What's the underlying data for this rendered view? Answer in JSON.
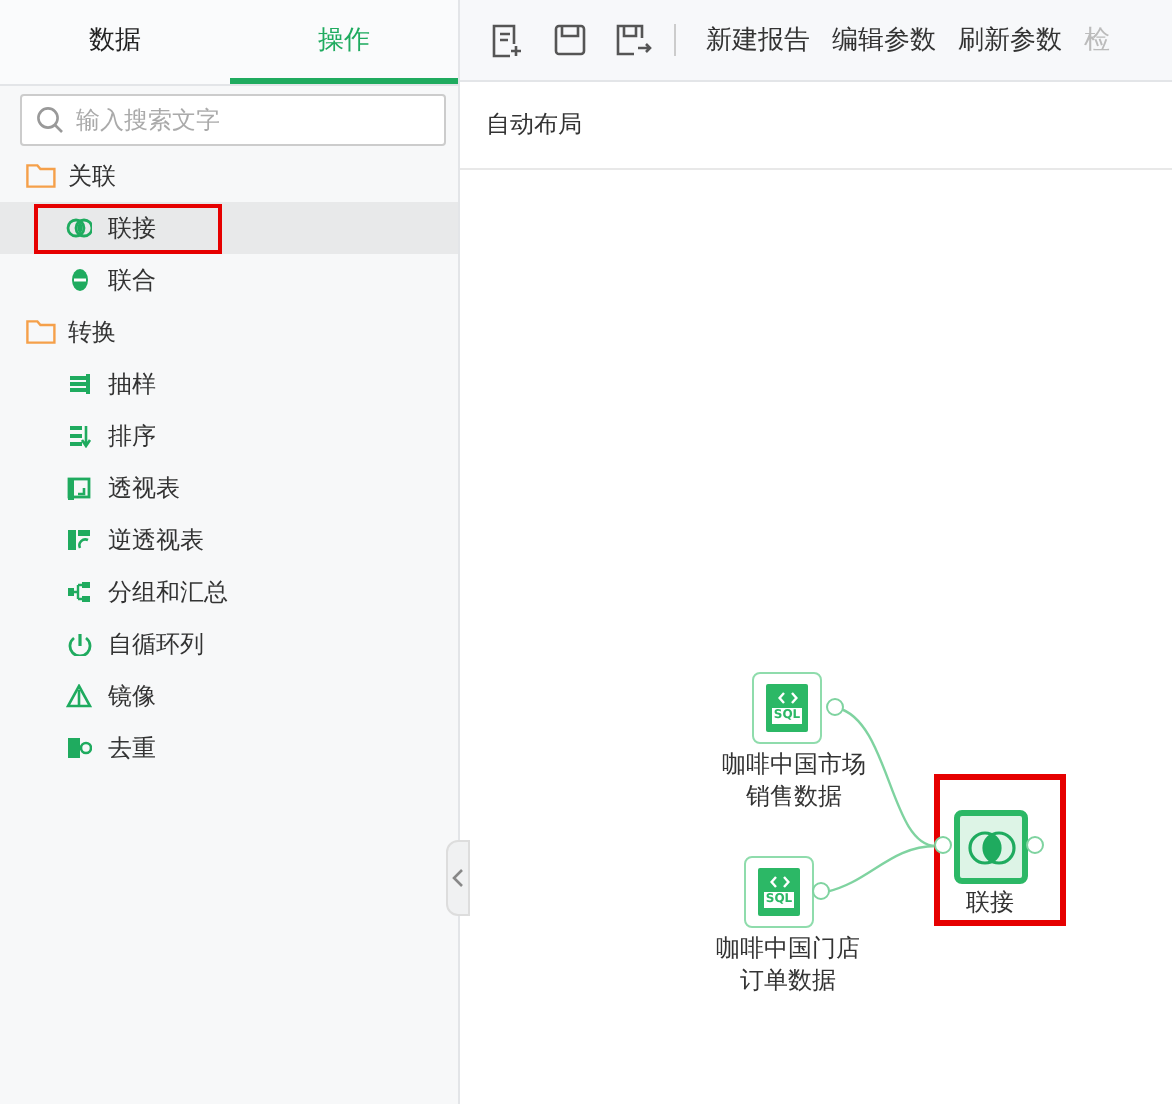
{
  "left_tabs": [
    {
      "label": "数据",
      "selected": false
    },
    {
      "label": "操作",
      "selected": true
    }
  ],
  "search": {
    "placeholder": "输入搜索文字"
  },
  "tree": [
    {
      "label": "关联",
      "children": [
        {
          "label": "联接",
          "selected": true,
          "highlighted": true
        },
        {
          "label": "联合",
          "selected": false,
          "highlighted": false
        }
      ]
    },
    {
      "label": "转换",
      "children": [
        {
          "label": "抽样",
          "selected": false,
          "highlighted": false
        },
        {
          "label": "排序",
          "selected": false,
          "highlighted": false
        },
        {
          "label": "透视表",
          "selected": false,
          "highlighted": false
        },
        {
          "label": "逆透视表",
          "selected": false,
          "highlighted": false
        },
        {
          "label": "分组和汇总",
          "selected": false,
          "highlighted": false
        },
        {
          "label": "自循环列",
          "selected": false,
          "highlighted": false
        },
        {
          "label": "镜像",
          "selected": false,
          "highlighted": false
        },
        {
          "label": "去重",
          "selected": false,
          "highlighted": false
        }
      ]
    }
  ],
  "toolbar": {
    "actions": [
      {
        "label": "新建报告",
        "disabled": false
      },
      {
        "label": "编辑参数",
        "disabled": false
      },
      {
        "label": "刷新参数",
        "disabled": false
      },
      {
        "label": "检",
        "disabled": true
      }
    ]
  },
  "subbar": {
    "label": "自动布局"
  },
  "canvas": {
    "nodes": [
      {
        "kind": "sql",
        "icon_text": "SQL",
        "label_lines": [
          "咖啡中国市场",
          "销售数据"
        ],
        "highlighted": false
      },
      {
        "kind": "sql",
        "icon_text": "SQL",
        "label_lines": [
          "咖啡中国门店",
          "订单数据"
        ],
        "highlighted": false
      },
      {
        "kind": "join",
        "label_lines": [
          "联接"
        ],
        "highlighted": true
      }
    ]
  }
}
